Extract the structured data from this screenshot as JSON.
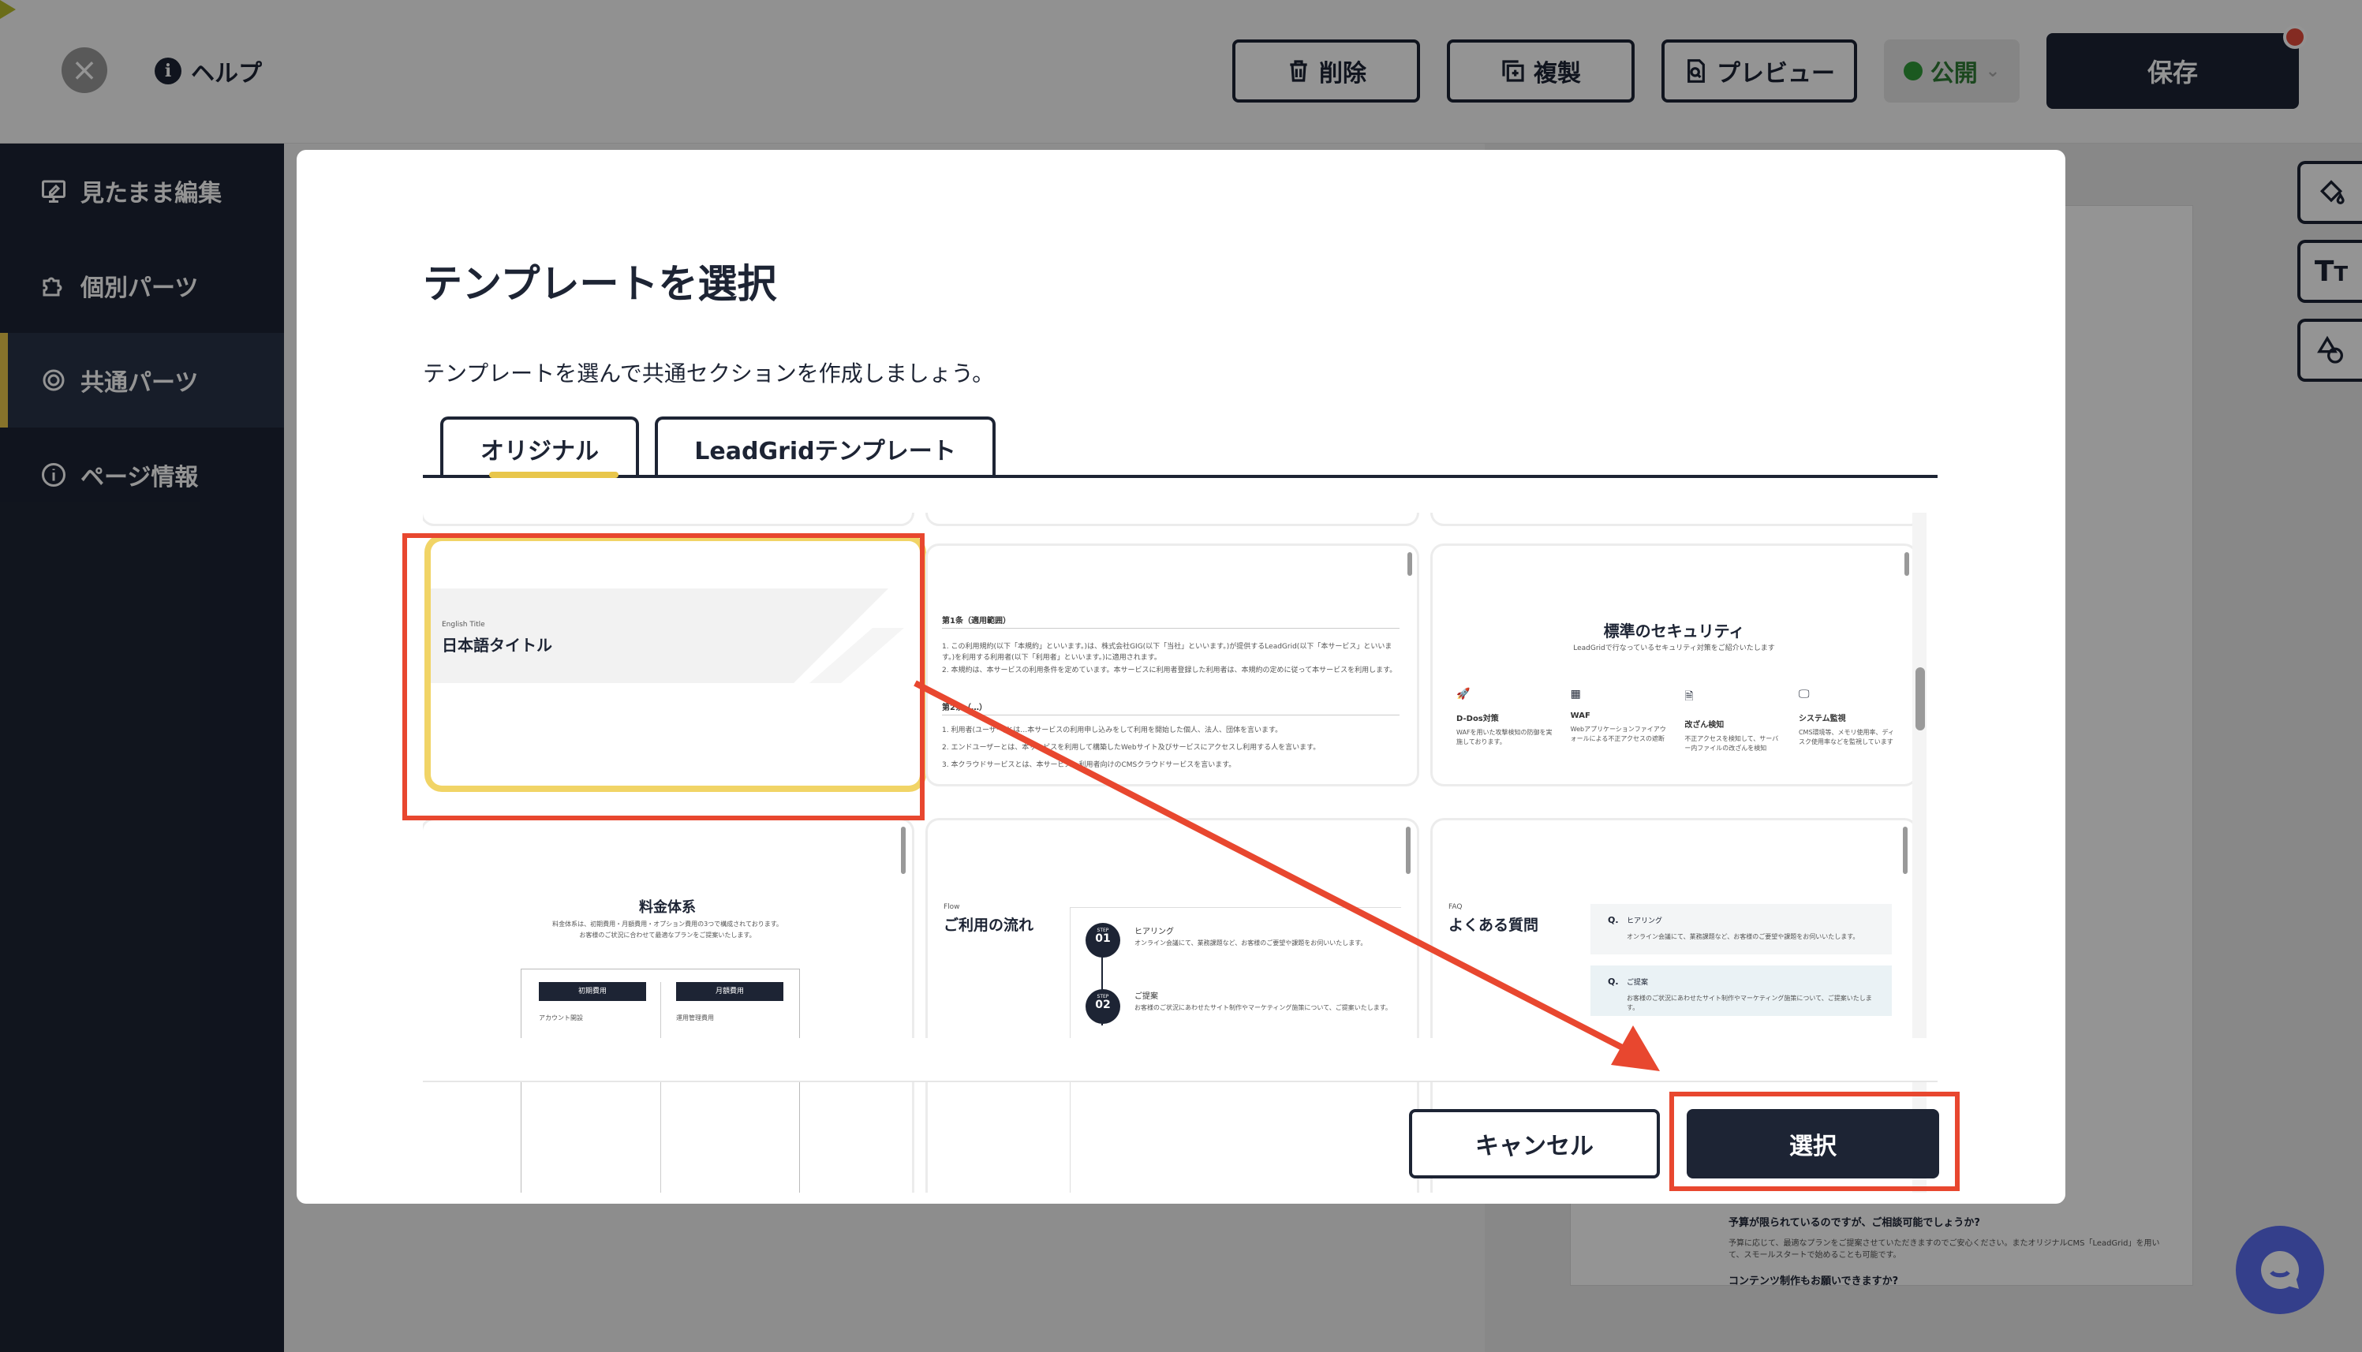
{
  "header": {
    "close_icon": "×",
    "help_label": "ヘルプ",
    "delete_label": "削除",
    "duplicate_label": "複製",
    "preview_label": "プレビュー",
    "publish_label": "公開",
    "save_label": "保存"
  },
  "sidebar": {
    "items": [
      {
        "label": "見たまま編集"
      },
      {
        "label": "個別パーツ"
      },
      {
        "label": "共通パーツ"
      },
      {
        "label": "ページ情報"
      }
    ]
  },
  "modal": {
    "title": "テンプレートを選択",
    "description": "テンプレートを選んで共通セクションを作成しましょう。",
    "tabs": [
      {
        "label": "オリジナル"
      },
      {
        "label": "LeadGridテンプレート"
      }
    ],
    "cancel_label": "キャンセル",
    "select_label": "選択"
  },
  "cards": {
    "title_card": {
      "eyebrow": "English Title",
      "heading": "日本語タイトル"
    },
    "terms_card": {
      "sec1": "第1条（適用範囲）",
      "line1": "1. この利用規約(以下「本規約」といいます。)は、株式会社GIG(以下「当社」といいます。)が提供するLeadGrid(以下「本サービス」といいます。)を利用する利用者(以下「利用者」といいます。)に適用されます。",
      "line2": "2. 本規約は、本サービスの利用条件を定めています。本サービスに利用者登録した利用者は、本規約の定めに従って本サービスを利用します。",
      "sec2": "第2条（…）",
      "line3": "1. 利用者(ユーザー)とは…本サービスの利用申し込みをして利用を開始した個人、法人、団体を言います。",
      "line4": "2. エンドユーザーとは、本サービスを利用して構築したWebサイト及びサービスにアクセスし利用する人を言います。",
      "line5": "3. 本クラウドサービスとは、本サービス…利用者向けのCMSクラウドサービスを言います。"
    },
    "security_card": {
      "title": "標準のセキュリティ",
      "subtitle": "LeadGridで行なっているセキュリティ対策をご紹介いたします",
      "items": [
        {
          "label": "D-Dos対策",
          "text": "WAFを用いた攻撃検知の防御を実施しております。"
        },
        {
          "label": "WAF",
          "text": "Webアプリケーションファイアウォールによる不正アクセスの遮断"
        },
        {
          "label": "改ざん検知",
          "text": "不正アクセスを検知して、サーバー内ファイルの改ざんを検知"
        },
        {
          "label": "システム監視",
          "text": "CMS環境等、メモリ使用率、ディスク使用率などを監視しています"
        }
      ]
    },
    "pricing_card": {
      "title": "料金体系",
      "desc1": "料金体系は、初期費用・月額費用・オプション費用の3つで構成されております。",
      "desc2": "お客様のご状況に合わせて最適なプランをご提案いたします。",
      "col1": "初期費用",
      "col2": "月額費用",
      "row1a": "アカウント開設",
      "row1b": "運用管理費用"
    },
    "flow_card": {
      "eyebrow": "Flow",
      "heading": "ご利用の流れ",
      "steps": [
        {
          "label": "STEP",
          "num": "01",
          "title": "ヒアリング",
          "text": "オンライン会議にて、業務課題など、お客様のご要望や課題をお伺いいたします。"
        },
        {
          "label": "STEP",
          "num": "02",
          "title": "ご提案",
          "text": "お客様のご状況にあわせたサイト制作やマーケティング施策について、ご提案いたします。"
        }
      ]
    },
    "faq_card": {
      "eyebrow": "FAQ",
      "heading": "よくある質問",
      "items": [
        {
          "q": "Q.",
          "title": "ヒアリング",
          "text": "オンライン会議にて、業務課題など、お客様のご要望や課題をお伺いいたします。"
        },
        {
          "q": "Q.",
          "title": "ご提案",
          "text": "お客様のご状況にあわせたサイト制作やマーケティング施策について、ご提案いたします。"
        }
      ]
    }
  },
  "background": {
    "faq_q1": "予算が限られているのですが、ご相談可能でしょうか?",
    "faq_a1": "予算に応じて、最適なプランをご提案させていただきますのでご安心ください。またオリジナルCMS「LeadGrid」を用いて、スモールスタートで始めることも可能です。",
    "faq_q2": "コンテンツ制作もお願いできますか?"
  },
  "colors": {
    "navy": "#1d2434",
    "accent_yellow": "#e8c64b",
    "annotation_red": "#e8472f",
    "publish_green": "#2f9a38"
  }
}
